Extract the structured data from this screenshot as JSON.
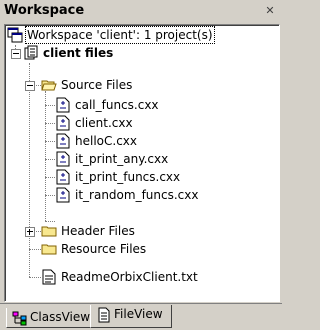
{
  "window": {
    "title": "Workspace",
    "close_glyph": "✕"
  },
  "tree": {
    "root": {
      "label": "Workspace 'client': 1 project(s)",
      "icon": "workspace-icon"
    },
    "project": {
      "label": "client files",
      "icon": "project-icon",
      "expanded": true
    },
    "source_folder": {
      "label": "Source Files",
      "icon": "folder-open-icon",
      "expanded": true,
      "files": [
        {
          "label": "call_funcs.cxx",
          "icon": "cpp-file-icon"
        },
        {
          "label": "client.cxx",
          "icon": "cpp-file-icon"
        },
        {
          "label": "helloC.cxx",
          "icon": "cpp-file-icon"
        },
        {
          "label": "it_print_any.cxx",
          "icon": "cpp-file-icon"
        },
        {
          "label": "it_print_funcs.cxx",
          "icon": "cpp-file-icon"
        },
        {
          "label": "it_random_funcs.cxx",
          "icon": "cpp-file-icon"
        }
      ]
    },
    "header_folder": {
      "label": "Header Files",
      "icon": "folder-closed-icon",
      "expanded": false
    },
    "resource_folder": {
      "label": "Resource Files",
      "icon": "folder-closed-icon"
    },
    "readme": {
      "label": "ReadmeOrbixClient.txt",
      "icon": "text-file-icon"
    }
  },
  "tabs": [
    {
      "label": "ClassView",
      "icon": "classview-icon",
      "active": false
    },
    {
      "label": "FileView",
      "icon": "fileview-icon",
      "active": true
    }
  ]
}
